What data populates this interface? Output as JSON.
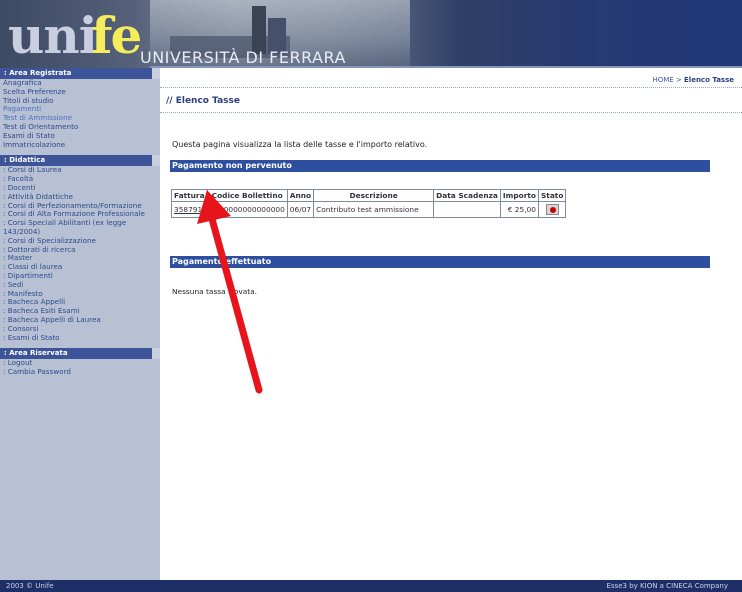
{
  "brand": {
    "logo_uni": "uni",
    "logo_fe": "fe",
    "university_name": "UNIVERSITÀ DI FERRARA"
  },
  "sidebar": {
    "sections": [
      {
        "title": "Area Registrata",
        "items": [
          "Anagrafica",
          "Scelta Preferenze",
          "Titoli di studio",
          "Pagamenti",
          "Test di Ammissione",
          "Test di Orientamento",
          "Esami di Stato",
          "Immatricolazione"
        ]
      },
      {
        "title": "Didattica",
        "items": [
          "Corsi di Laurea",
          "Facoltà",
          "Docenti",
          "Attività Didattiche",
          "Corsi di Perfezionamento/Formazione",
          "Corsi di Alta Formazione Professionale",
          "Corsi Speciali Abilitanti (ex legge 143/2004)",
          "Corsi di Specializzazione",
          "Dottorati di ricerca",
          "Master",
          "Classi di laurea",
          "Dipartimenti",
          "Sedi",
          "Manifesto",
          "Bacheca Appelli",
          "Bacheca Esiti Esami",
          "Bacheca Appelli di Laurea",
          "Consorsi",
          "Esami di Stato"
        ]
      },
      {
        "title": "Area Riservata",
        "items": [
          "Logout",
          "Cambia Password"
        ]
      }
    ]
  },
  "breadcrumb": {
    "home": "HOME",
    "separator": " > ",
    "current": "Elenco Tasse"
  },
  "page_title": "// Elenco Tasse",
  "intro_text": "Questa pagina visualizza la lista delle tasse e l'importo relativo.",
  "section_not_received": "Pagamento non pervenuto",
  "table": {
    "headers": [
      "Fattura",
      "Codice Bollettino",
      "Anno",
      "Descrizione",
      "Data Scadenza",
      "Importo",
      "Stato"
    ],
    "rows": [
      {
        "fattura": "358791",
        "codice": "0000000000000000",
        "anno": "06/07",
        "descrizione": "Contributo test ammissione",
        "scadenza": "",
        "importo": "€ 25,00"
      }
    ]
  },
  "section_received": "Pagamento effettuato",
  "no_results": "Nessuna tassa trovata.",
  "footer": {
    "copyright": "2003 © Unife",
    "powered": "Esse3 by KION a CINECA Company"
  },
  "colors": {
    "accent": "#2e4ea0",
    "sidebar_bg": "#b8c1d4",
    "arrow": "#e8141c"
  }
}
